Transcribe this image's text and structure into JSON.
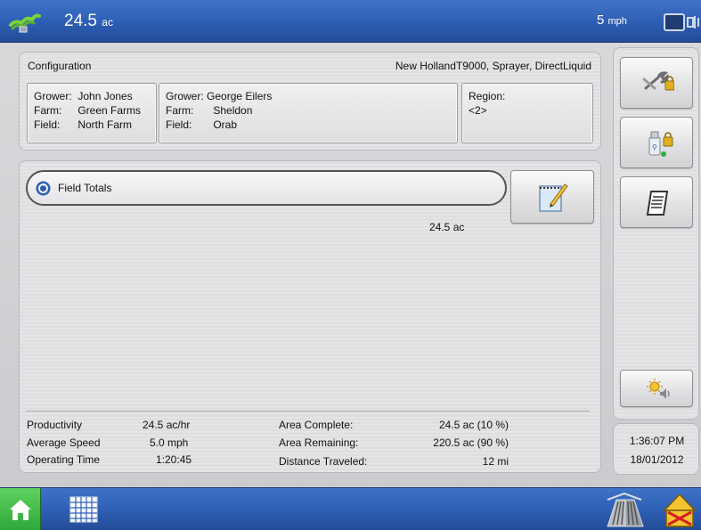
{
  "header": {
    "area_value": "24.5",
    "area_unit": "ac",
    "speed_value": "5",
    "speed_unit": "mph",
    "icons": [
      "gps-signal-icon",
      "display-status-icon"
    ]
  },
  "configuration": {
    "title": "Configuration",
    "vehicle": "New HollandT9000, Sprayer, DirectLiquid",
    "operation_box": {
      "grower_label": "Grower:",
      "grower": "John Jones",
      "farm_label": "Farm:",
      "farm": "Green Farms",
      "field_label": "Field:",
      "field": "North Farm"
    },
    "management_box": {
      "grower_label": "Grower:",
      "grower": "George Eilers",
      "farm_label": "Farm:",
      "farm": "Sheldon",
      "field_label": "Field:",
      "field": "Orab"
    },
    "region_box": {
      "region_label": "Region:",
      "region": "<2>"
    }
  },
  "field_totals": {
    "label": "Field Totals",
    "total_area": "24.5 ac"
  },
  "stats": {
    "productivity_label": "Productivity",
    "productivity": "24.5 ac/hr",
    "average_speed_label": "Average Speed",
    "average_speed": "5.0 mph",
    "operating_time_label": "Operating Time",
    "operating_time": "1:20:45",
    "area_complete_label": "Area Complete:",
    "area_complete": "24.5 ac (10 %)",
    "area_remaining_label": "Area Remaining:",
    "area_remaining": "220.5 ac (90 %)",
    "distance_traveled_label": "Distance Traveled:",
    "distance_traveled": "12 mi"
  },
  "clock": {
    "time": "1:36:07 PM",
    "date": "18/01/2012"
  },
  "side_buttons": [
    "setup-lock-icon",
    "usb-lock-icon",
    "report-icon",
    "brightness-volume-icon"
  ],
  "bottom_bar": {
    "icons": [
      "home-icon",
      "grid-icon",
      "drive-icon",
      "warning-icon"
    ]
  },
  "colors": {
    "bar_blue": "#2d5eb3",
    "home_green": "#2fa83a",
    "panel": "#e4e4e6"
  }
}
